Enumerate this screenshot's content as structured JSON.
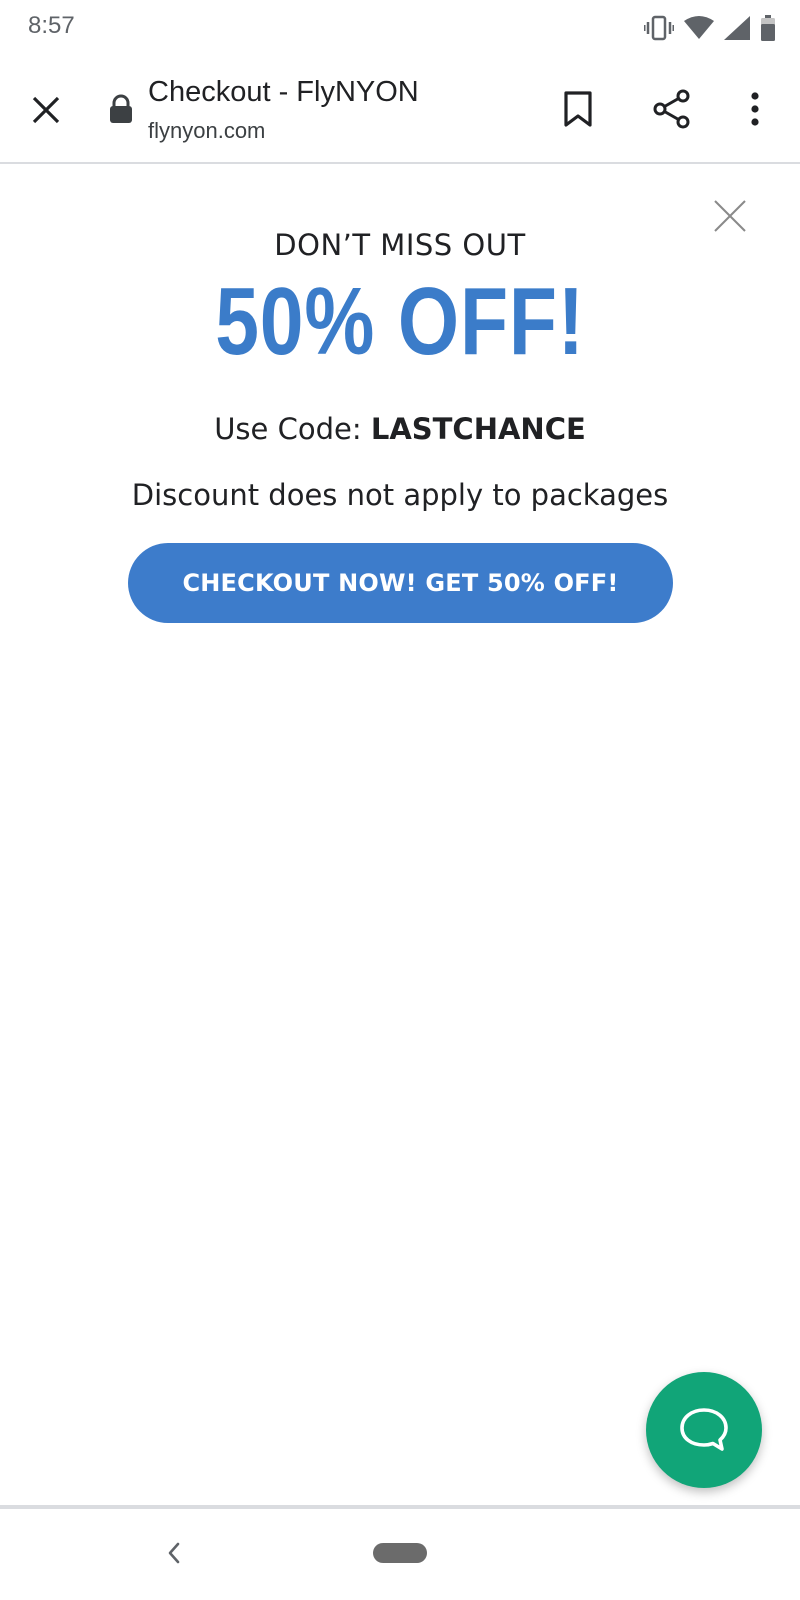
{
  "status_bar": {
    "time": "8:57",
    "icons": [
      "vibrate-icon",
      "wifi-icon",
      "cell-signal-icon",
      "battery-icon"
    ]
  },
  "browser": {
    "page_title": "Checkout - FlyNYON",
    "url": "flynyon.com",
    "icons": [
      "close-icon",
      "lock-icon",
      "bookmark-icon",
      "share-icon",
      "more-vert-icon"
    ]
  },
  "popup": {
    "eyebrow": "DON’T MISS OUT",
    "headline": "50% OFF!",
    "code_prefix": "Use Code: ",
    "code": "LASTCHANCE",
    "note": "Discount does not apply to packages",
    "cta_label": "CHECKOUT NOW! GET 50% OFF!"
  },
  "chat": {
    "icon": "chat-bubble-icon"
  },
  "nav": {
    "icons": [
      "back-icon",
      "home-pill"
    ]
  },
  "colors": {
    "accent_blue": "#3d7ccb",
    "headline_blue": "#3b7cc9",
    "chat_green": "#11a578",
    "text_dark": "#202124"
  }
}
